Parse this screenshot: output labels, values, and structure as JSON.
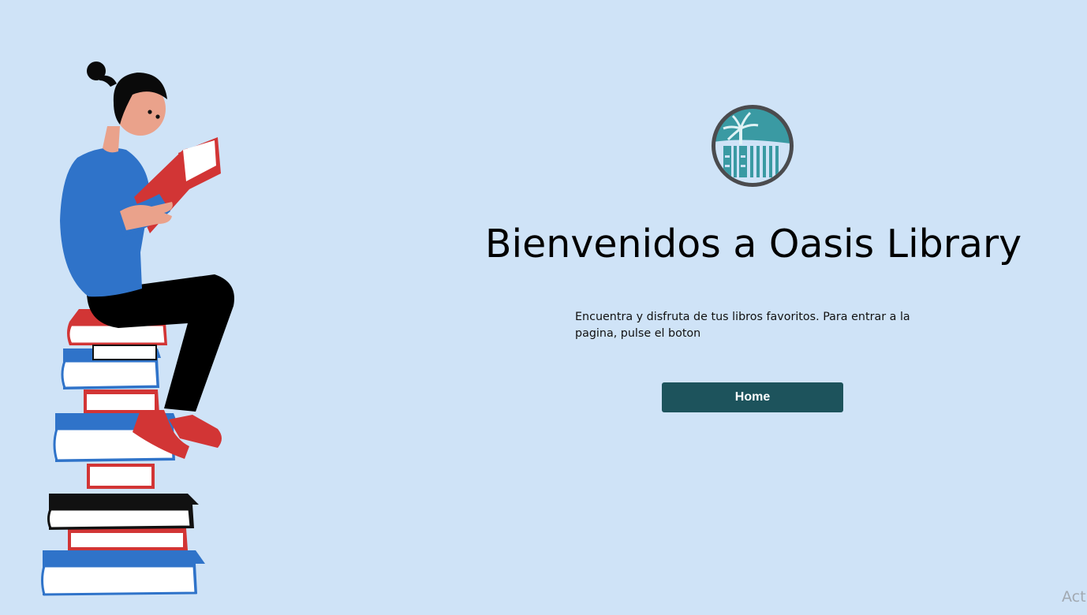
{
  "page": {
    "title": "Bienvenidos a Oasis Library",
    "intro": "Encuentra y disfruta de tus libros favoritos. Para entrar a la pagina, pulse el boton",
    "home_button_label": "Home",
    "watermark": "Acti"
  },
  "icons": {
    "logo": "oasis-library-logo-icon",
    "illustration": "woman-reading-on-book-stack-illustration"
  },
  "colors": {
    "background": "#cfe3f7",
    "button": "#1d535c",
    "button_text": "#ffffff",
    "logo_teal": "#3a9aa3",
    "logo_ring": "#4b4b4e"
  }
}
